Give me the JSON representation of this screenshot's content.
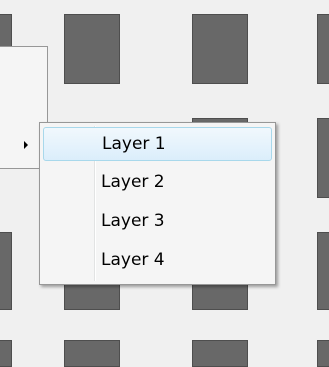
{
  "icons": {
    "submenu_arrow": "triangle-right-icon"
  },
  "colors": {
    "background": "#f0f0f0",
    "tile": "#686868",
    "menu_background": "#f5f5f5",
    "menu_border": "#979797",
    "hover_border": "#a8d8eb",
    "hover_fill": "#dbeefb"
  },
  "layer_menu": {
    "items": [
      {
        "label": "Layer 1",
        "highlighted": true
      },
      {
        "label": "Layer 2",
        "highlighted": false
      },
      {
        "label": "Layer 3",
        "highlighted": false
      },
      {
        "label": "Layer 4",
        "highlighted": false
      }
    ]
  }
}
